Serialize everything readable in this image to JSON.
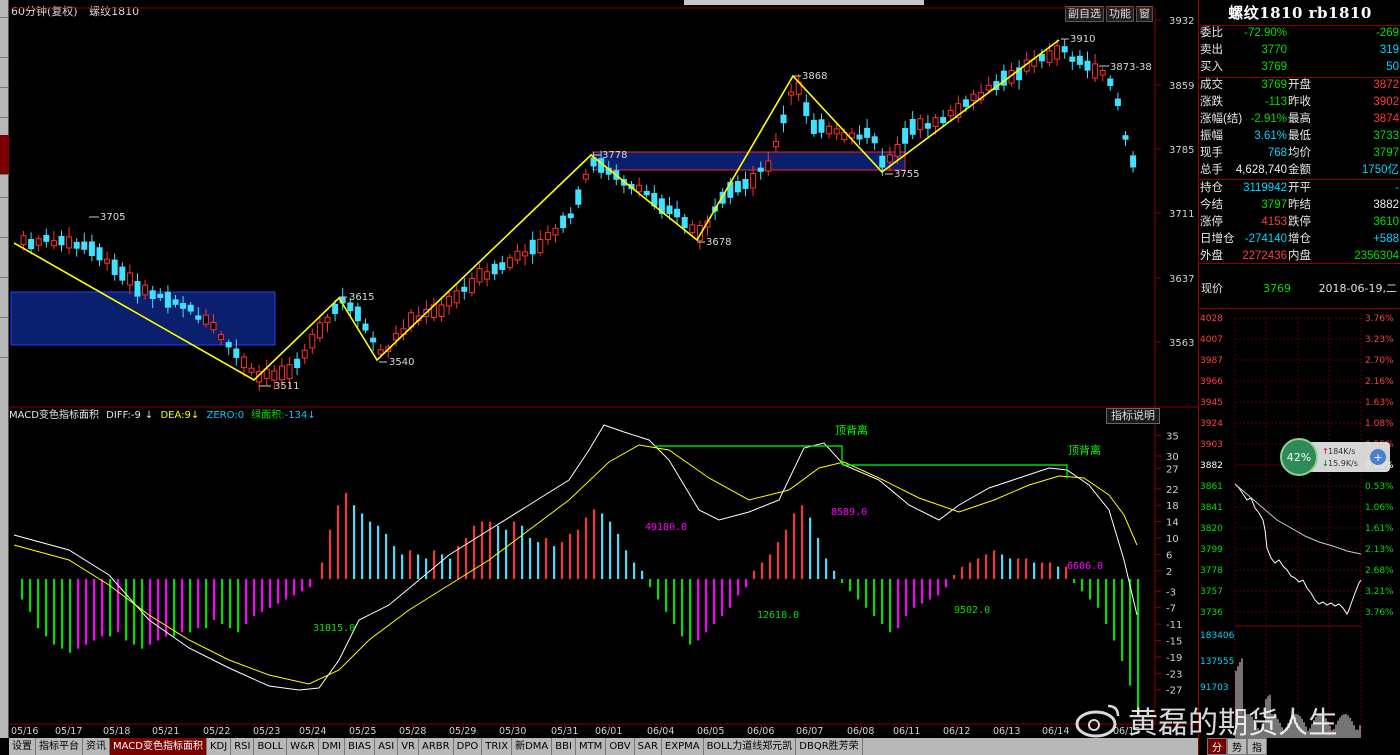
{
  "header": {
    "period": "60分钟(复权)",
    "symbol": "螺纹1810"
  },
  "toolbar": {
    "buttons": [
      "副自选",
      "功能",
      "窗",
      "□"
    ]
  },
  "price_axis": [
    "3932",
    "3859",
    "3785",
    "3711",
    "3637",
    "3563"
  ],
  "macd_axis": [
    "35",
    "30",
    "27",
    "22",
    "18",
    "14",
    "10",
    "6",
    "2",
    "-3",
    "-7",
    "-11",
    "-15",
    "-19",
    "-23",
    "-27"
  ],
  "date_axis": [
    "05/16",
    "05/17",
    "05/18",
    "05/21",
    "05/22",
    "05/23",
    "05/24",
    "05/25",
    "05/28",
    "05/29",
    "05/30",
    "05/31",
    "06/01",
    "06/04",
    "06/05",
    "06/06",
    "06/07",
    "06/08",
    "06/11",
    "06/12",
    "06/13",
    "06/14",
    "06/15"
  ],
  "price_annotations": {
    "p3705": "3705",
    "p3511": "3511",
    "p3615": "3615",
    "p3540": "3540",
    "p3778": "3778",
    "p3678": "3678",
    "p3868": "3868",
    "p3755": "3755",
    "p3910": "3910",
    "p3873": "3873-38"
  },
  "macd": {
    "title": "MACD变色指标面积",
    "diff_label": "DIFF:",
    "diff_value": "-9",
    "dea_label": "DEA:",
    "dea_value": "9",
    "zero_label": "ZERO:",
    "zero_value": "0",
    "green_area_label": "绿面积:",
    "green_area_value": "-134",
    "index_button": "指标说明",
    "divergence_labels": [
      "顶背离",
      "顶背离"
    ],
    "area_values": [
      "31815.0",
      "49180.0",
      "12618.0",
      "8589.0",
      "9502.0",
      "6606.0"
    ]
  },
  "bottom_tabs": [
    "设置",
    "指标平台",
    "资讯",
    "MACD变色指标面积",
    "KDJ",
    "RSI",
    "BOLL",
    "W&R",
    "DMI",
    "BIAS",
    "ASI",
    "VR",
    "ARBR",
    "DPO",
    "TRIX",
    "新DMA",
    "BBI",
    "MTM",
    "OBV",
    "SAR",
    "EXPMA",
    "BOLL力道线郑元凯",
    "DBQR胜芳荣"
  ],
  "quote": {
    "title": "螺纹1810 rb1810",
    "rows": [
      {
        "l": "委比",
        "v1": "-72.90%",
        "c1": "green",
        "l2": "",
        "v2": "-269",
        "c2": "green"
      },
      {
        "l": "卖出",
        "v1": "3770",
        "c1": "green",
        "l2": "",
        "v2": "319",
        "c2": "cyan"
      },
      {
        "l": "买入",
        "v1": "3769",
        "c1": "green",
        "l2": "",
        "v2": "50",
        "c2": "cyan"
      },
      {
        "l": "成交",
        "v1": "3769",
        "c1": "green",
        "l2": "开盘",
        "v2": "3872",
        "c2": "red"
      },
      {
        "l": "涨跌",
        "v1": "-113",
        "c1": "green",
        "l2": "昨收",
        "v2": "3902",
        "c2": "red"
      },
      {
        "l": "涨幅(结)",
        "v1": "-2.91%",
        "c1": "green",
        "l2": "最高",
        "v2": "3874",
        "c2": "red"
      },
      {
        "l": "振幅",
        "v1": "3.61%",
        "c1": "cyan",
        "l2": "最低",
        "v2": "3733",
        "c2": "green"
      },
      {
        "l": "现手",
        "v1": "768",
        "c1": "cyan",
        "l2": "均价",
        "v2": "3797",
        "c2": "green"
      },
      {
        "l": "总手",
        "v1": "4,628,740",
        "c1": "white",
        "l2": "金额",
        "v2": "1750亿",
        "c2": "cyan"
      },
      {
        "l": "持仓",
        "v1": "3119942",
        "c1": "cyan",
        "l2": "开平",
        "v2": "-",
        "c2": "cyan"
      },
      {
        "l": "今结",
        "v1": "3797",
        "c1": "green",
        "l2": "昨结",
        "v2": "3882",
        "c2": "white"
      },
      {
        "l": "涨停",
        "v1": "4153",
        "c1": "red",
        "l2": "跌停",
        "v2": "3610",
        "c2": "green"
      },
      {
        "l": "日增仓",
        "v1": "-274140",
        "c1": "cyan",
        "l2": "增仓",
        "v2": "+588",
        "c2": "cyan"
      },
      {
        "l": "外盘",
        "v1": "2272436",
        "c1": "red",
        "l2": "内盘",
        "v2": "2356304",
        "c2": "green"
      }
    ],
    "now_label": "现价",
    "now_value": "3769",
    "date": "2018-06-19,二"
  },
  "mini_chart": {
    "price_axis": [
      "4028",
      "4007",
      "3987",
      "3966",
      "3945",
      "3924",
      "3903",
      "3882",
      "3861",
      "3841",
      "3820",
      "3799",
      "3778",
      "3757",
      "3736"
    ],
    "pct_axis": [
      "3.76%",
      "3.23%",
      "2.70%",
      "2.16%",
      "1.63%",
      "1.08%",
      "0.55%",
      "0.00%",
      "0.53%",
      "1.06%",
      "1.61%",
      "2.13%",
      "2.68%",
      "3.21%",
      "3.76%"
    ],
    "volume_axis": [
      "183406",
      "137555",
      "91703"
    ],
    "tabs": [
      "分",
      "势",
      "指"
    ]
  },
  "net_badge": {
    "percent": "42%",
    "up": "184K/s",
    "down": "15.9K/s"
  },
  "watermark": "黄磊的期货人生"
}
